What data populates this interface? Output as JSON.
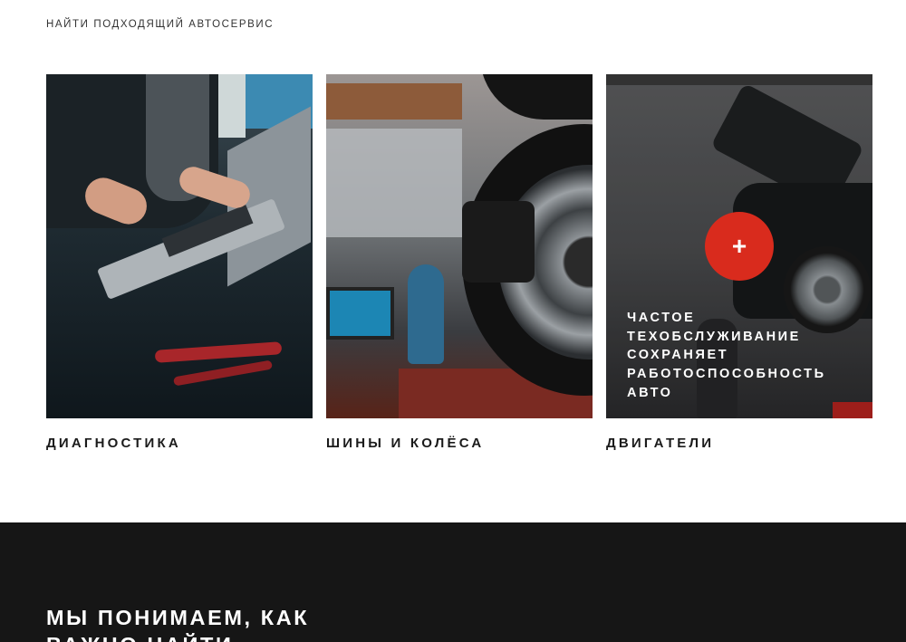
{
  "section": {
    "eyebrow": "НАЙТИ ПОДХОДЯЩИЙ АВТОСЕРВИС"
  },
  "cards": [
    {
      "title": "ДИАГНОСТИКА"
    },
    {
      "title": "ШИНЫ И КОЛЁСА"
    },
    {
      "title": "ДВИГАТЕЛИ",
      "overlay_button": "+",
      "overlay_text": "ЧАСТОЕ ТЕХОБСЛУЖИВАНИЕ СОХРАНЯЕТ РАБОТОСПОСОБНОСТЬ АВТО"
    }
  ],
  "dark_section": {
    "heading": "МЫ ПОНИМАЕМ, КАК ВАЖНО НАЙТИ"
  },
  "colors": {
    "accent": "#d92b1d",
    "dark_background": "#161616"
  }
}
